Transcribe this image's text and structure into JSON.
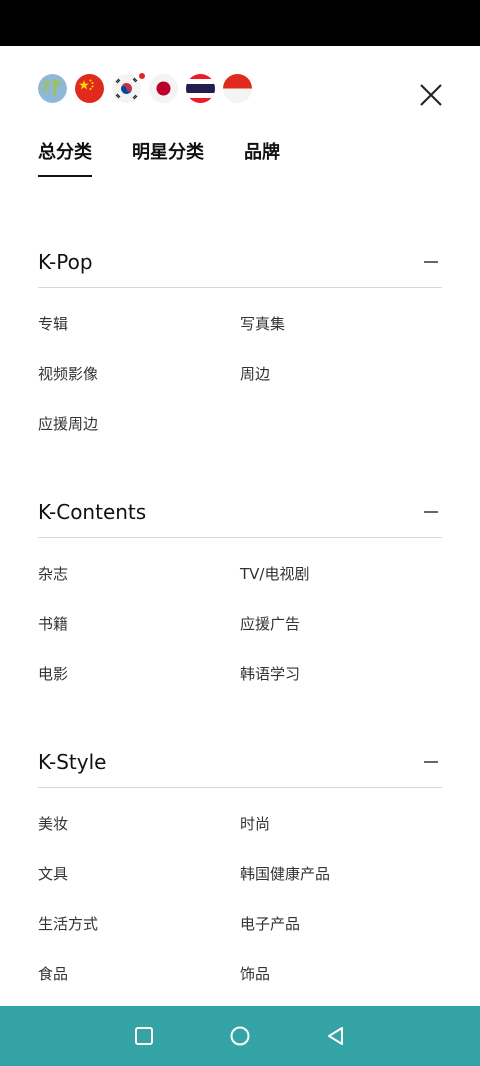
{
  "language_flags": [
    {
      "icon": "globe-icon",
      "code": "global"
    },
    {
      "icon": "china-flag-icon",
      "code": "zh",
      "selected": true
    },
    {
      "icon": "korea-flag-icon",
      "code": "ko"
    },
    {
      "icon": "japan-flag-icon",
      "code": "ja"
    },
    {
      "icon": "thailand-flag-icon",
      "code": "th"
    },
    {
      "icon": "indonesia-flag-icon",
      "code": "id"
    }
  ],
  "tabs": [
    {
      "label": "总分类",
      "active": true
    },
    {
      "label": "明星分类",
      "active": false
    },
    {
      "label": "品牌",
      "active": false
    }
  ],
  "sections": [
    {
      "title": "K-Pop",
      "items": [
        "专辑",
        "写真集",
        "视频影像",
        "周边",
        "应援周边"
      ]
    },
    {
      "title": "K-Contents",
      "items": [
        "杂志",
        "TV/电视剧",
        "书籍",
        "应援广告",
        "电影",
        "韩语学习"
      ]
    },
    {
      "title": "K-Style",
      "items": [
        "美妆",
        "时尚",
        "文具",
        "韩国健康产品",
        "生活方式",
        "电子产品",
        "食品",
        "饰品"
      ]
    }
  ],
  "colors": {
    "nav_bar": "#33a3a6",
    "status_bar": "#000000",
    "divider": "#d9d9d9"
  }
}
